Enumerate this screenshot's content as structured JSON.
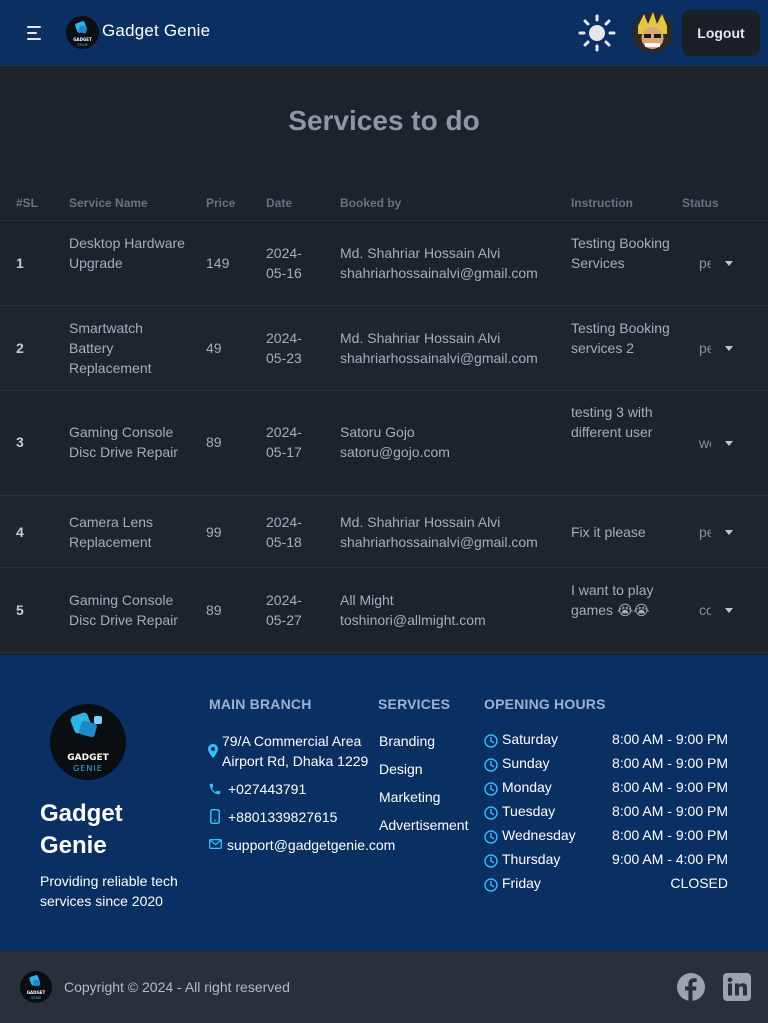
{
  "navbar": {
    "brand": "Gadget Genie",
    "logout_label": "Logout"
  },
  "main": {
    "title": "Services to do",
    "columns": [
      "#SL",
      "Service Name",
      "Price",
      "Date",
      "Booked by",
      "Instruction",
      "Status"
    ],
    "rows": [
      {
        "sl": "1",
        "service": "Desktop Hardware Upgrade",
        "price": "149",
        "date": "2024-05-16",
        "name": "Md. Shahriar Hossain Alvi",
        "email": "shahriarhossainalvi@gmail.com",
        "instruction": "Testing Booking Services",
        "status": "pending"
      },
      {
        "sl": "2",
        "service": "Smartwatch Battery Replacement",
        "price": "49",
        "date": "2024-05-23",
        "name": "Md. Shahriar Hossain Alvi",
        "email": "shahriarhossainalvi@gmail.com",
        "instruction": "Testing Booking services 2",
        "status": "pending"
      },
      {
        "sl": "3",
        "service": "Gaming Console Disc Drive Repair",
        "price": "89",
        "date": "2024-05-17",
        "name": "Satoru Gojo",
        "email": "satoru@gojo.com",
        "instruction": "testing 3 with different user",
        "status": "working"
      },
      {
        "sl": "4",
        "service": "Camera Lens Replacement",
        "price": "99",
        "date": "2024-05-18",
        "name": "Md. Shahriar Hossain Alvi",
        "email": "shahriarhossainalvi@gmail.com",
        "instruction": "Fix it please",
        "status": "pending"
      },
      {
        "sl": "5",
        "service": "Gaming Console Disc Drive Repair",
        "price": "89",
        "date": "2024-05-27",
        "name": "All Might",
        "email": "toshinori@allmight.com",
        "instruction": "I want to play games 😭😭",
        "status": "completed"
      }
    ]
  },
  "footer": {
    "brand_line1": "Gadget",
    "brand_line2": "Genie",
    "tagline": "Providing reliable tech services since 2020",
    "branch_heading": "MAIN BRANCH",
    "address_line1": "79/A Commercial Area",
    "address_line2": "Airport Rd, Dhaka 1229",
    "phone": "+027443791",
    "mobile": "+8801339827615",
    "email": "support@gadgetgenie.com",
    "services_heading": "SERVICES",
    "services": [
      "Branding",
      "Design",
      "Marketing",
      "Advertisement"
    ],
    "hours_heading": "OPENING HOURS",
    "hours": [
      {
        "day": "Saturday",
        "time": "8:00 AM - 9:00 PM"
      },
      {
        "day": "Sunday",
        "time": "8:00 AM - 9:00 PM"
      },
      {
        "day": "Monday",
        "time": "8:00 AM - 9:00 PM"
      },
      {
        "day": "Tuesday",
        "time": "8:00 AM - 9:00 PM"
      },
      {
        "day": "Wednesday",
        "time": "8:00 AM - 9:00 PM"
      },
      {
        "day": "Thursday",
        "time": "9:00 AM - 4:00 PM"
      },
      {
        "day": "Friday",
        "time": "CLOSED"
      }
    ],
    "copyright": "Copyright © 2024 - All right reserved",
    "logo_text_top": "GADGET",
    "logo_text_bottom": "GENIE"
  },
  "colors": {
    "navbar": "#0b2f63",
    "body": "#1d232a",
    "footer": "#0a2f63",
    "accent": "#38bdf8"
  },
  "icons": [
    "menu-icon",
    "sun-icon",
    "location-pin-icon",
    "phone-icon",
    "mobile-icon",
    "mail-icon",
    "clock-icon",
    "facebook-icon",
    "linkedin-icon",
    "chevron-down-icon"
  ]
}
